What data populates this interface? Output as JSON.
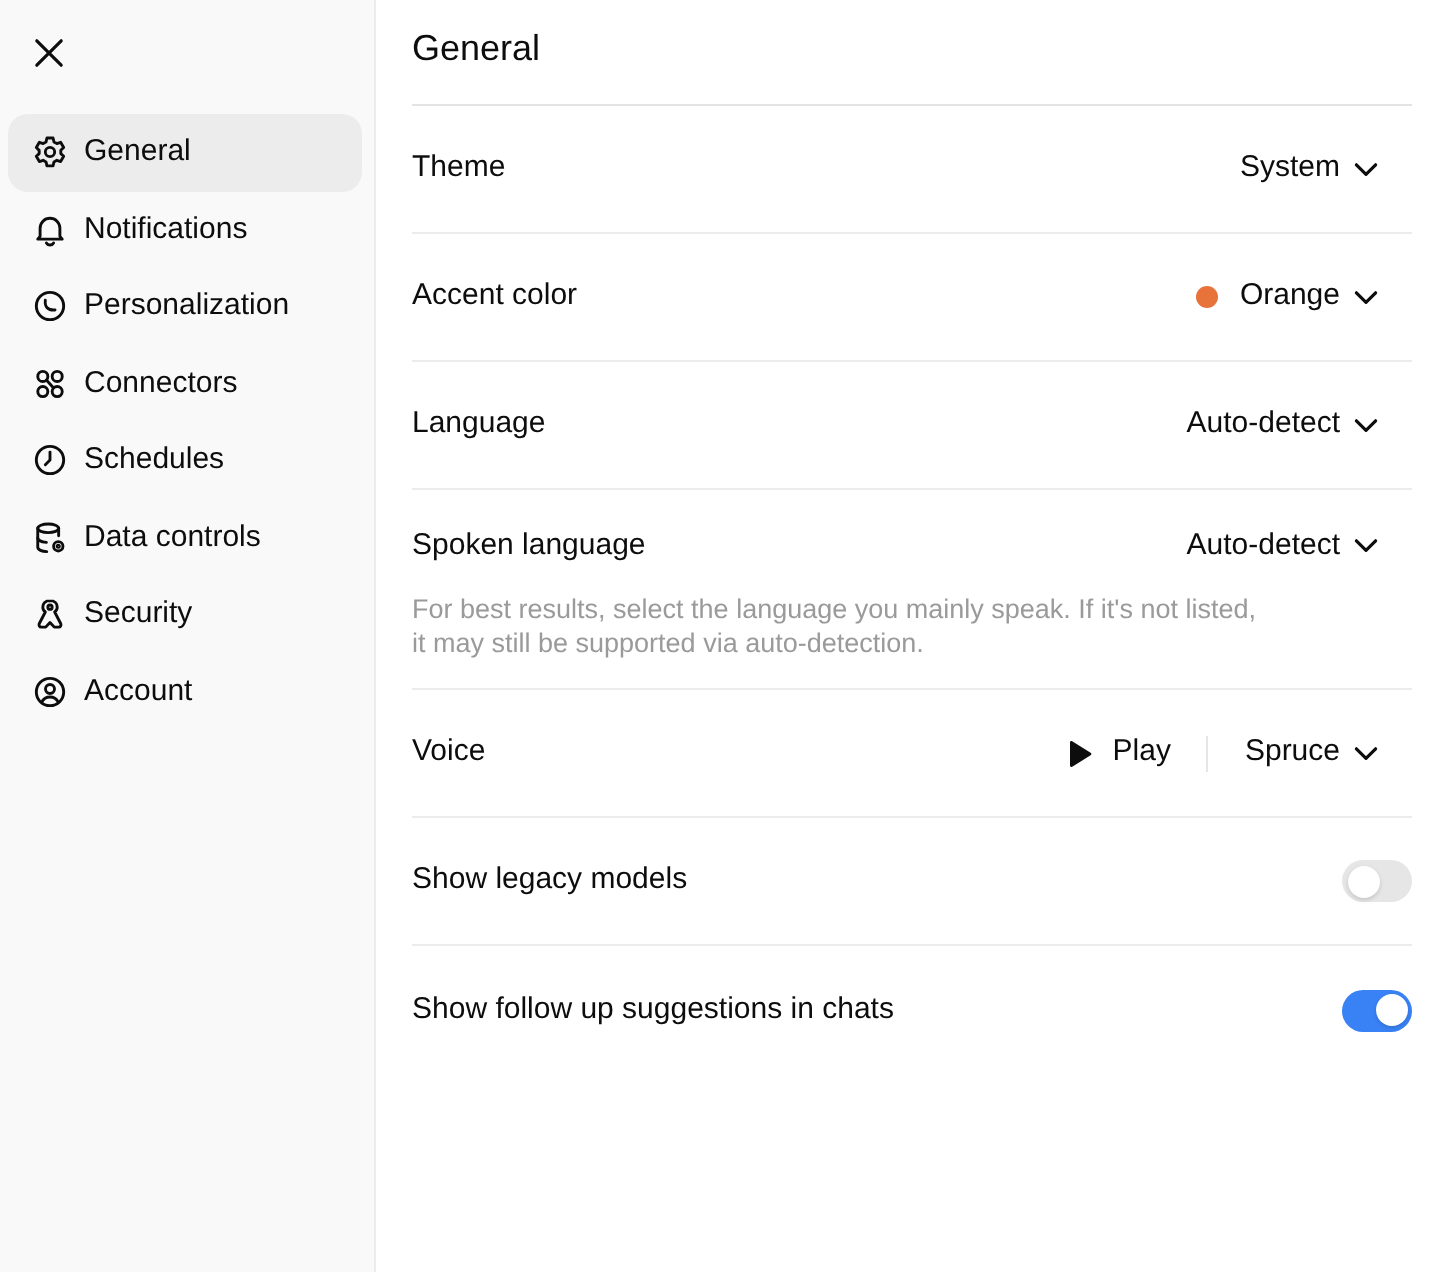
{
  "sidebar": {
    "items": [
      {
        "label": "General",
        "selected": true
      },
      {
        "label": "Notifications",
        "selected": false
      },
      {
        "label": "Personalization",
        "selected": false
      },
      {
        "label": "Connectors",
        "selected": false
      },
      {
        "label": "Schedules",
        "selected": false
      },
      {
        "label": "Data controls",
        "selected": false
      },
      {
        "label": "Security",
        "selected": false
      },
      {
        "label": "Account",
        "selected": false
      }
    ]
  },
  "panel": {
    "title": "General",
    "settings": [
      {
        "kind": "select",
        "label": "Theme",
        "value": "System"
      },
      {
        "kind": "select",
        "label": "Accent color",
        "value": "Orange",
        "color": "#e8733a"
      },
      {
        "kind": "select",
        "label": "Language",
        "value": "Auto-detect"
      },
      {
        "kind": "select",
        "label": "Spoken language",
        "value": "Auto-detect",
        "hint": "For best results, select the language you mainly speak. If it's not listed, it may still be supported via auto-detection."
      },
      {
        "kind": "voice",
        "label": "Voice",
        "play": "Play",
        "value": "Spruce"
      },
      {
        "kind": "toggle",
        "label": "Show legacy models",
        "on": false
      },
      {
        "kind": "toggle",
        "label": "Show follow up suggestions in chats",
        "on": true
      }
    ]
  }
}
